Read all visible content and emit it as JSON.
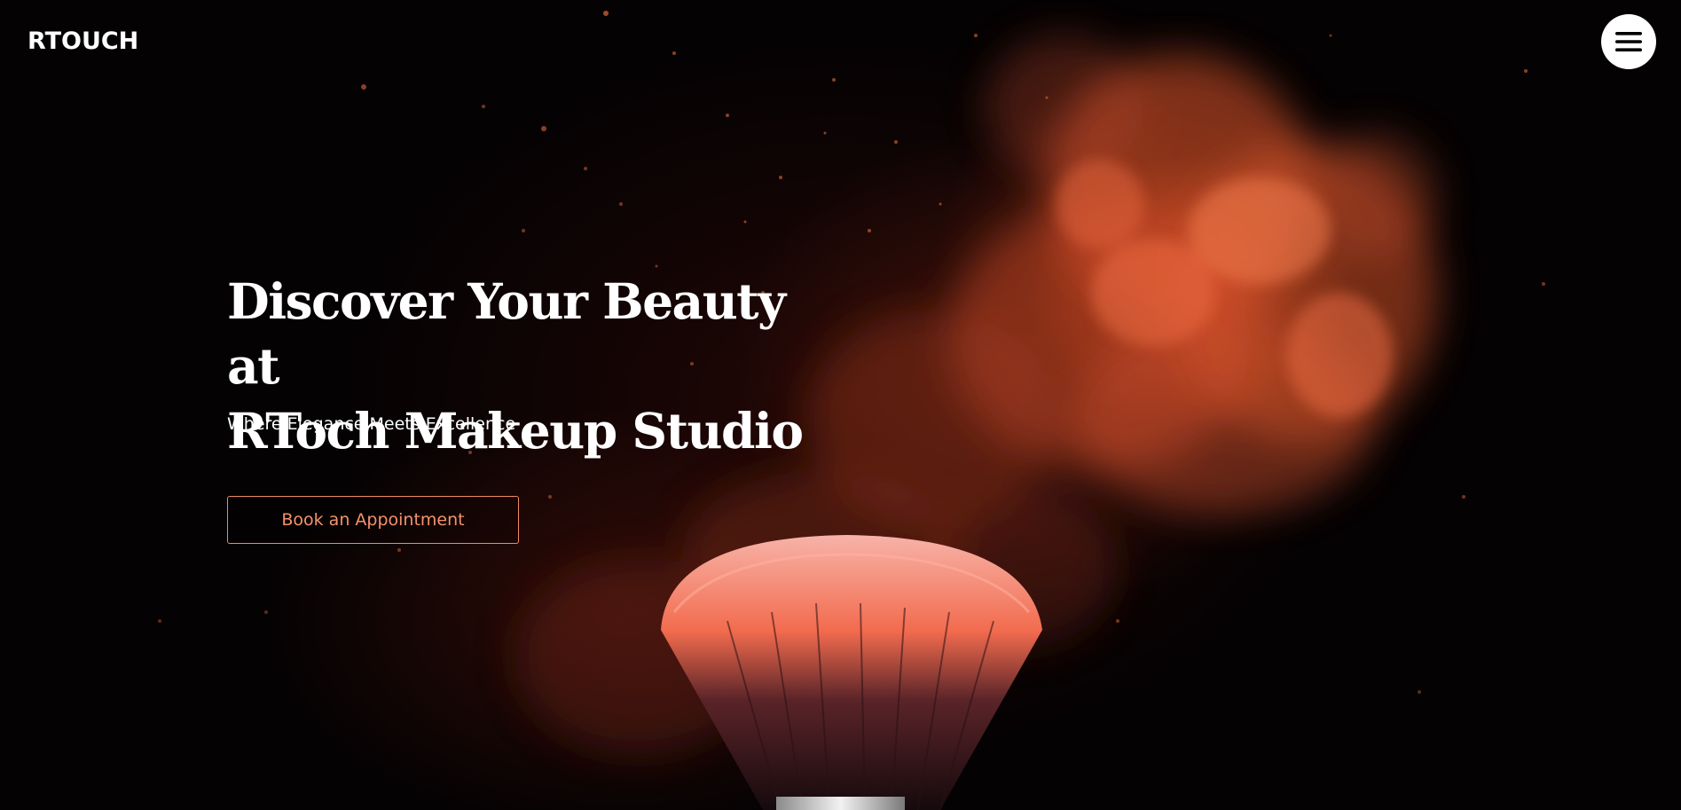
{
  "brand": {
    "logo_text": "RTOUCH"
  },
  "header": {
    "menu_icon": "hamburger-menu-icon"
  },
  "hero": {
    "title_line1": "Discover Your Beauty at",
    "title_line2": "RToch Makeup Studio",
    "subtitle": "Where Elegance Meets Excellence",
    "cta_label": "Book an Appointment"
  },
  "colors": {
    "background": "#050203",
    "accent": "#f08a62",
    "powder": "#e0552d",
    "text": "#ffffff"
  },
  "background_image": {
    "subject": "makeup-brush-with-orange-powder-burst"
  }
}
